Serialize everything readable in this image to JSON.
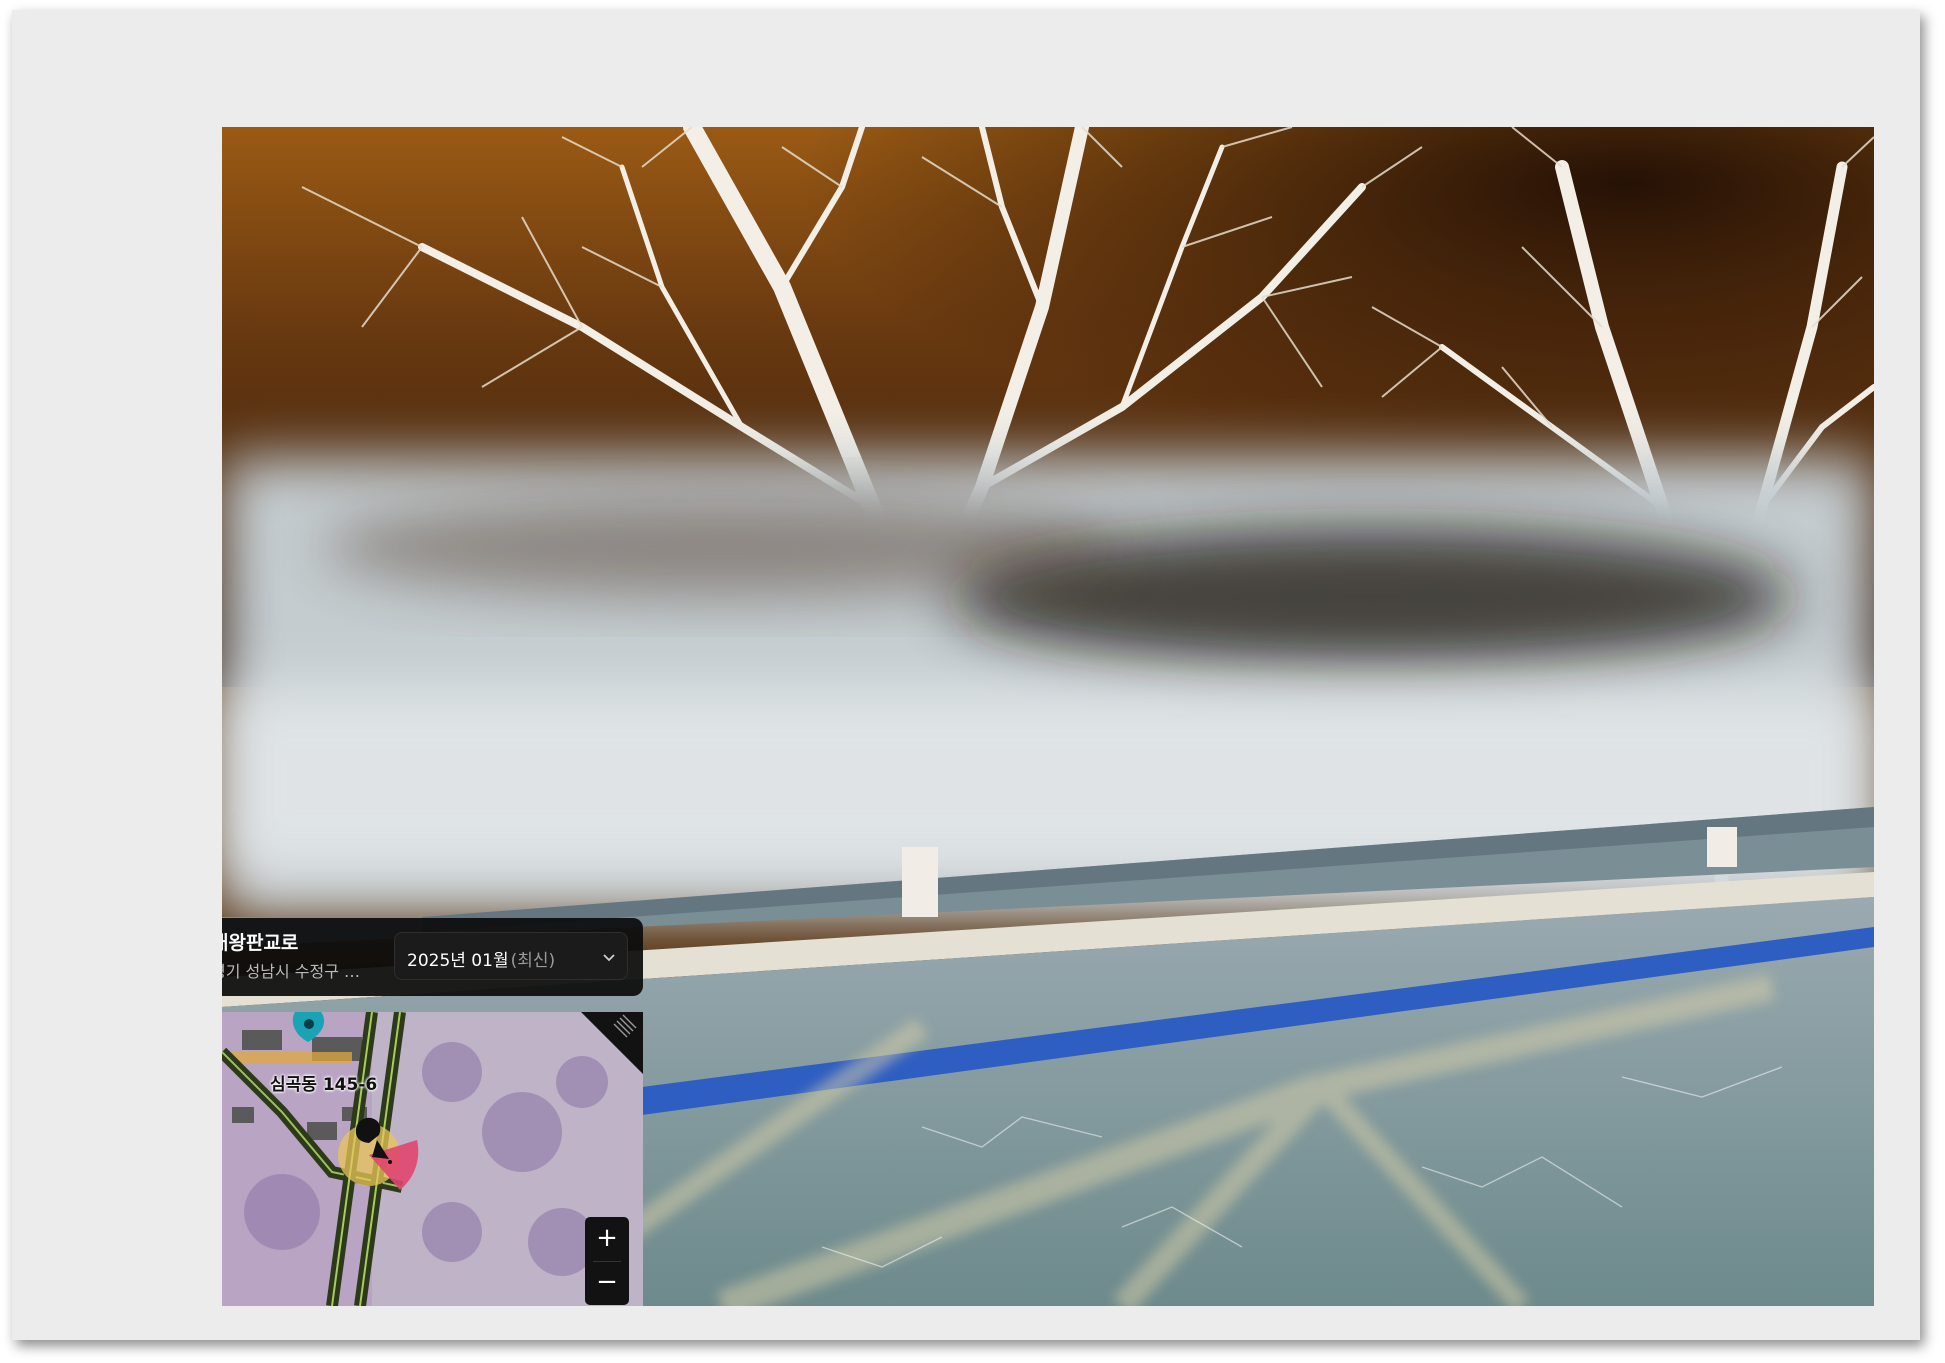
{
  "place": {
    "name": "대왕판교로",
    "address": "경기 성남시 수정구 …"
  },
  "date_selector": {
    "value": "2025년 01월",
    "tag": "(최신)"
  },
  "minimap": {
    "location_label": "심곡동 145-6"
  },
  "zoom": {
    "in_label": "+",
    "out_label": "−"
  },
  "colors": {
    "panel_bg": "#0c0c0c",
    "pin": "#1aa3b4",
    "view_cone": "#e0456e",
    "position_halo": "#e9c65a"
  },
  "icons": {
    "dropdown": "chevron-down-icon",
    "pin": "map-pin-icon",
    "position": "position-marker-icon",
    "resize": "resize-handle-icon"
  }
}
